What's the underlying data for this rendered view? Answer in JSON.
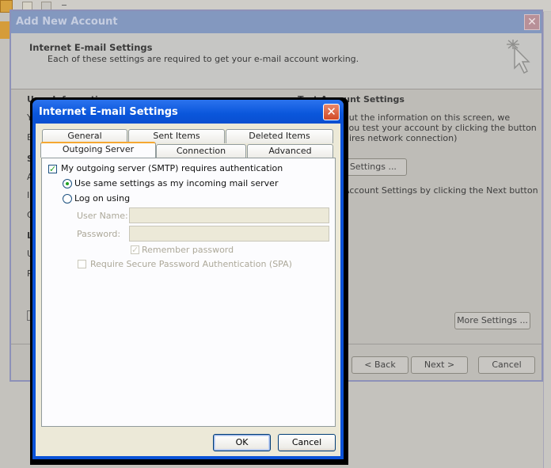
{
  "background_app": {
    "toolbar_icons": [
      "outlook-app-icon",
      "send-receive-icon",
      "undo-icon"
    ]
  },
  "wizard": {
    "title": "Add New Account",
    "header_title": "Internet E-mail Settings",
    "header_subtitle": "Each of these settings are required to get your e-mail account working.",
    "user_info_heading": "User Information",
    "left_fragments": [
      "Yo",
      "E",
      "Se",
      "Ac",
      "In",
      "O",
      "Lo",
      "U",
      "Pa"
    ],
    "test_heading": "Test Account Settings",
    "test_line1": "out the information on this screen, we",
    "test_line2": "you test your account by clicking the button",
    "test_line3": "uires network connection)",
    "test_button_label": "nt Settings ...",
    "next_hint": "Account Settings by clicking the Next button",
    "more_settings_label": "More Settings ...",
    "back_label": "< Back",
    "next_label": "Next >",
    "cancel_label": "Cancel"
  },
  "dialog": {
    "title": "Internet E-mail Settings",
    "tabs_row1": [
      "General",
      "Sent Items",
      "Deleted Items"
    ],
    "tabs_row2": [
      "Outgoing Server",
      "Connection",
      "Advanced"
    ],
    "active_tab": "Outgoing Server",
    "smtp_auth_label": "My outgoing server (SMTP) requires authentication",
    "smtp_auth_checked": true,
    "radio_same_label": "Use same settings as my incoming mail server",
    "radio_same_selected": true,
    "radio_logon_label": "Log on using",
    "radio_logon_selected": false,
    "username_label": "User Name:",
    "username_value": "",
    "password_label": "Password:",
    "password_value": "",
    "remember_label": "Remember password",
    "remember_checked": true,
    "spa_label": "Require Secure Password Authentication (SPA)",
    "spa_checked": false,
    "ok_label": "OK",
    "cancel_label": "Cancel"
  }
}
